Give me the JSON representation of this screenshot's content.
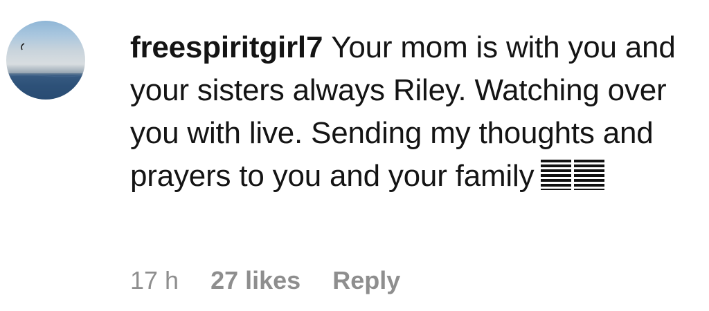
{
  "comment": {
    "username": "freespiritgirl7",
    "text": "Your mom is with you and your sisters always Riley. Watching over you with live. Sending my thoughts and prayers to you and your family",
    "emoji_icons": [
      "unsupported-glyph-icon",
      "unsupported-glyph-icon"
    ],
    "time": "17 h",
    "likes": "27 likes",
    "reply_label": "Reply"
  },
  "avatar": {
    "icon": "profile-photo-seascape-icon"
  },
  "colors": {
    "text": "#141414",
    "meta": "#8e8e8e"
  }
}
